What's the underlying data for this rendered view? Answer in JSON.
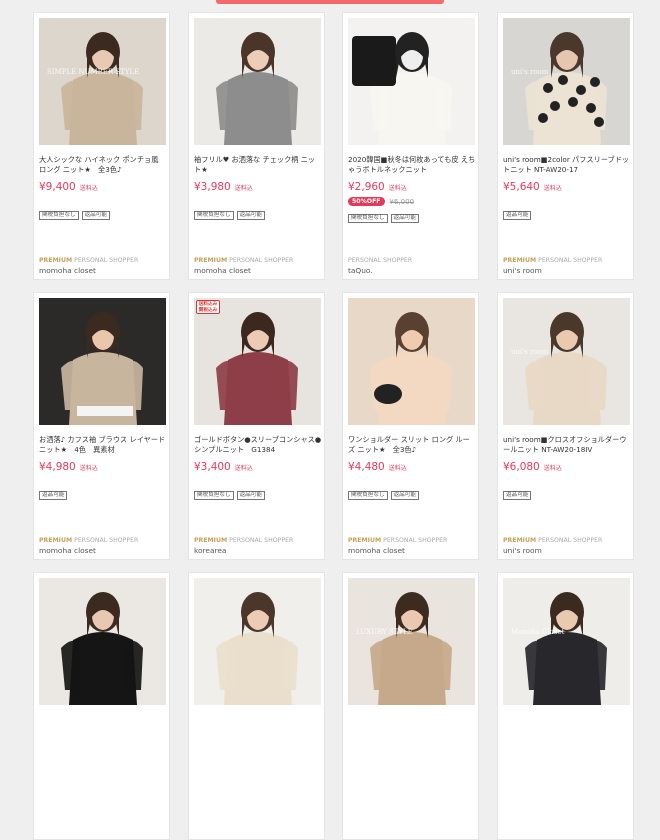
{
  "rows": [
    [
      {
        "title": "大人シックな ハイネック ポンチョ風 ロング ニット★　全3色♪",
        "price": "¥9,400",
        "tax": "送料込",
        "sale": null,
        "tags": [
          "関税負担なし",
          "返品可能"
        ],
        "premium": "PREMIUM",
        "shopper": "PERSONAL SHOPPER",
        "shop": "momoha closet",
        "photo_overlay": "SIMPLE NUMBER STYLE"
      },
      {
        "title": "袖フリル♥ お洒落な チェック柄 ニット★",
        "price": "¥3,980",
        "tax": "送料込",
        "sale": null,
        "tags": [
          "関税負担なし",
          "返品可能"
        ],
        "premium": "PREMIUM",
        "shopper": "PERSONAL SHOPPER",
        "shop": "momoha closet",
        "photo_overlay": ""
      },
      {
        "title": "2020韓国■秋冬は何枚あっても皮 えちゃうボトルネックニット",
        "price": "¥2,960",
        "tax": "送料込",
        "sale": {
          "badge": "50%OFF",
          "original": "¥6,000"
        },
        "tags": [
          "関税負担なし",
          "返品可能"
        ],
        "premium": "",
        "shopper": "PERSONAL SHOPPER",
        "shop": "taQuo.",
        "photo_overlay": ""
      },
      {
        "title": "uni's room■2color パフスリーブドットニット NT-AW20-17",
        "price": "¥5,640",
        "tax": "送料込",
        "sale": null,
        "tags": [
          "返品可能"
        ],
        "premium": "PREMIUM",
        "shopper": "PERSONAL SHOPPER",
        "shop": "uni's room",
        "photo_overlay": "uni's room"
      }
    ],
    [
      {
        "title": "お洒落♪ カフス袖 ブラウス レイヤード ニット★　4色　異素材",
        "price": "¥4,980",
        "tax": "送料込",
        "sale": null,
        "tags": [
          "返品可能"
        ],
        "premium": "PREMIUM",
        "shopper": "PERSONAL SHOPPER",
        "shop": "momoha closet",
        "photo_overlay": ""
      },
      {
        "title": "ゴールドボタン●スリーブコンシャス●シンプルニット　G1384",
        "price": "¥3,400",
        "tax": "送料込",
        "sale": null,
        "tags": [
          "関税負担なし",
          "返品可能"
        ],
        "premium": "PREMIUM",
        "shopper": "PERSONAL SHOPPER",
        "shop": "korearea",
        "photo_overlay": "",
        "corner_badge": "送料込み 関税込み"
      },
      {
        "title": "ワンショルダー スリット ロング ルーズ ニット★　全3色♪",
        "price": "¥4,480",
        "tax": "送料込",
        "sale": null,
        "tags": [
          "関税負担なし",
          "返品可能"
        ],
        "premium": "PREMIUM",
        "shopper": "PERSONAL SHOPPER",
        "shop": "momoha closet",
        "photo_overlay": ""
      },
      {
        "title": "uni's room■クロスオフショルダーウールニット NT-AW20-18IV",
        "price": "¥6,080",
        "tax": "送料込",
        "sale": null,
        "tags": [
          "返品可能"
        ],
        "premium": "PREMIUM",
        "shopper": "PERSONAL SHOPPER",
        "shop": "uni's room",
        "photo_overlay": "uni's room"
      }
    ],
    [
      {
        "title": "",
        "price": "",
        "tax": "",
        "sale": null,
        "tags": [],
        "premium": "",
        "shopper": "",
        "shop": "",
        "photo_overlay": ""
      },
      {
        "title": "",
        "price": "",
        "tax": "",
        "sale": null,
        "tags": [],
        "premium": "",
        "shopper": "",
        "shop": "",
        "photo_overlay": ""
      },
      {
        "title": "",
        "price": "",
        "tax": "",
        "sale": null,
        "tags": [],
        "premium": "",
        "shopper": "",
        "shop": "",
        "photo_overlay": "LUXURY STYLE"
      },
      {
        "title": "",
        "price": "",
        "tax": "",
        "sale": null,
        "tags": [],
        "premium": "",
        "shopper": "",
        "shop": "",
        "photo_overlay": "Monoha Closet"
      }
    ]
  ]
}
